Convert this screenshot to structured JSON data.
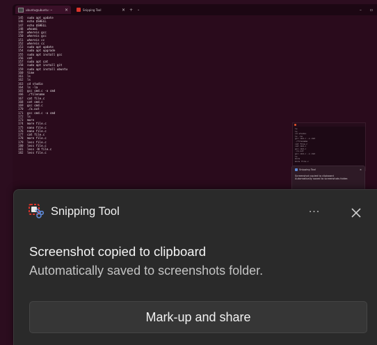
{
  "terminal": {
    "tabs": [
      {
        "label": "ubuntu@ubuntu: ~",
        "icon": "terminal-icon"
      },
      {
        "label": "Snipping Tool",
        "icon": "snipping-tool-icon"
      }
    ],
    "lines": [
      {
        "num": "145",
        "cmd": "sudo apt update"
      },
      {
        "num": "146",
        "cmd": "echo $SHELL"
      },
      {
        "num": "147",
        "cmd": "echo $SHELL"
      },
      {
        "num": "148",
        "cmd": "whoami"
      },
      {
        "num": "149",
        "cmd": "whereis gcc"
      },
      {
        "num": "150",
        "cmd": "whereis gcc"
      },
      {
        "num": "151",
        "cmd": "whereis cc"
      },
      {
        "num": "152",
        "cmd": "whereis cc"
      },
      {
        "num": "153",
        "cmd": "sudo apt update"
      },
      {
        "num": "154",
        "cmd": "sudo apt upgrade"
      },
      {
        "num": "155",
        "cmd": "sudo apt install gcc"
      },
      {
        "num": "156",
        "cmd": "cat"
      },
      {
        "num": "157",
        "cmd": "sudo apt cat"
      },
      {
        "num": "158",
        "cmd": "sudo apt install git"
      },
      {
        "num": "159",
        "cmd": "sudo apt install ubuntu"
      },
      {
        "num": "160",
        "cmd": "time"
      },
      {
        "num": "161",
        "cmd": "ls"
      },
      {
        "num": "162",
        "cmd": "ls"
      },
      {
        "num": "163",
        "cmd": "cd studio"
      },
      {
        "num": "164",
        "cmd": "ls -la"
      },
      {
        "num": "165",
        "cmd": "gcc cmd.c -o cmd"
      },
      {
        "num": "166",
        "cmd": "./filename"
      },
      {
        "num": "167",
        "cmd": "cat file.c"
      },
      {
        "num": "168",
        "cmd": "cat cmd.c"
      },
      {
        "num": "169",
        "cmd": "gcc cmd.c"
      },
      {
        "num": "170",
        "cmd": "./a.out"
      },
      {
        "num": "171",
        "cmd": "gcc cmd.c -o cmd"
      },
      {
        "num": "172",
        "cmd": "ls"
      },
      {
        "num": "173",
        "cmd": "more"
      },
      {
        "num": "174",
        "cmd": "more file.c"
      },
      {
        "num": "175",
        "cmd": "nano file.c"
      },
      {
        "num": "176",
        "cmd": "nano file.c"
      },
      {
        "num": "177",
        "cmd": "cat file.c"
      },
      {
        "num": "178",
        "cmd": "more file.c"
      },
      {
        "num": "179",
        "cmd": "less file.c"
      },
      {
        "num": "180",
        "cmd": "less file.c"
      },
      {
        "num": "181",
        "cmd": "less -N file.c"
      },
      {
        "num": "182",
        "cmd": "less file.c"
      }
    ]
  },
  "mini_notification": {
    "app": "Snipping Tool",
    "title": "Screenshot copied to clipboard",
    "subtitle": "Automatically saved to screenshots folder."
  },
  "notification": {
    "app_name": "Snipping Tool",
    "more_label": "···",
    "title": "Screenshot copied to clipboard",
    "subtitle": "Automatically saved to screenshots folder.",
    "action_label": "Mark-up and share"
  },
  "colors": {
    "terminal_bg": "#2a0b1c",
    "notification_bg": "#2a2a2a",
    "button_bg": "#363636",
    "snip_red": "#d9342b",
    "snip_blue": "#5f8ad8"
  }
}
